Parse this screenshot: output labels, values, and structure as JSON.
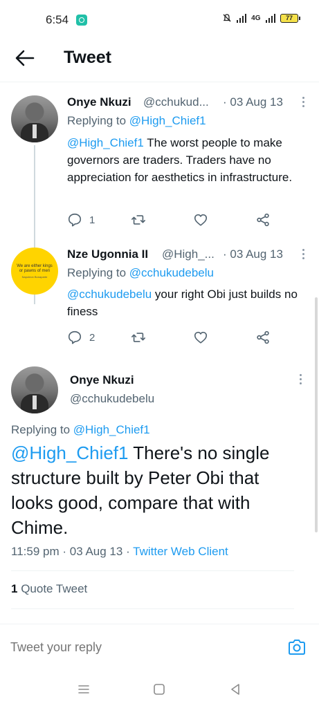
{
  "status_bar": {
    "time": "6:54",
    "network": "4G",
    "battery": "77"
  },
  "header": {
    "title": "Tweet"
  },
  "replies": [
    {
      "name": "Onye Nkuzi",
      "handle": "@cchukud...",
      "date": "· 03 Aug 13",
      "replying_prefix": "Replying to",
      "replying_to": "@High_Chief1",
      "mention": "@High_Chief1",
      "text": "The worst people to make governors are traders. Traders have no appreciation for aesthetics in infrastructure.",
      "reply_count": "1",
      "retweet_count": "",
      "like_count": ""
    },
    {
      "name": "Nze Ugonnia II",
      "handle": "@High_...",
      "date": "· 03 Aug 13",
      "replying_prefix": "Replying to",
      "replying_to": "@cchukudebelu",
      "mention": "@cchukudebelu",
      "text": "your right Obi just builds no finess",
      "reply_count": "2",
      "retweet_count": "",
      "like_count": "",
      "avatar_text": "We are either kings or pawns of men",
      "avatar_subtext": "Napoleon Bonaparte"
    }
  ],
  "main_tweet": {
    "name": "Onye Nkuzi",
    "handle": "@cchukudebelu",
    "replying_prefix": "Replying to",
    "replying_to": "@High_Chief1",
    "mention": "@High_Chief1",
    "text": "There's no single structure built by Peter Obi that looks good, compare that with Chime.",
    "time": "11:59 pm",
    "date": "03 Aug 13",
    "client": "Twitter Web Client",
    "quote_count": "1",
    "quote_label": "Quote Tweet"
  },
  "compose": {
    "placeholder": "Tweet your reply"
  },
  "colors": {
    "accent": "#1d9bf0",
    "text": "#0f1419",
    "secondary": "#536471",
    "avatar_yellow": "#ffd400"
  }
}
